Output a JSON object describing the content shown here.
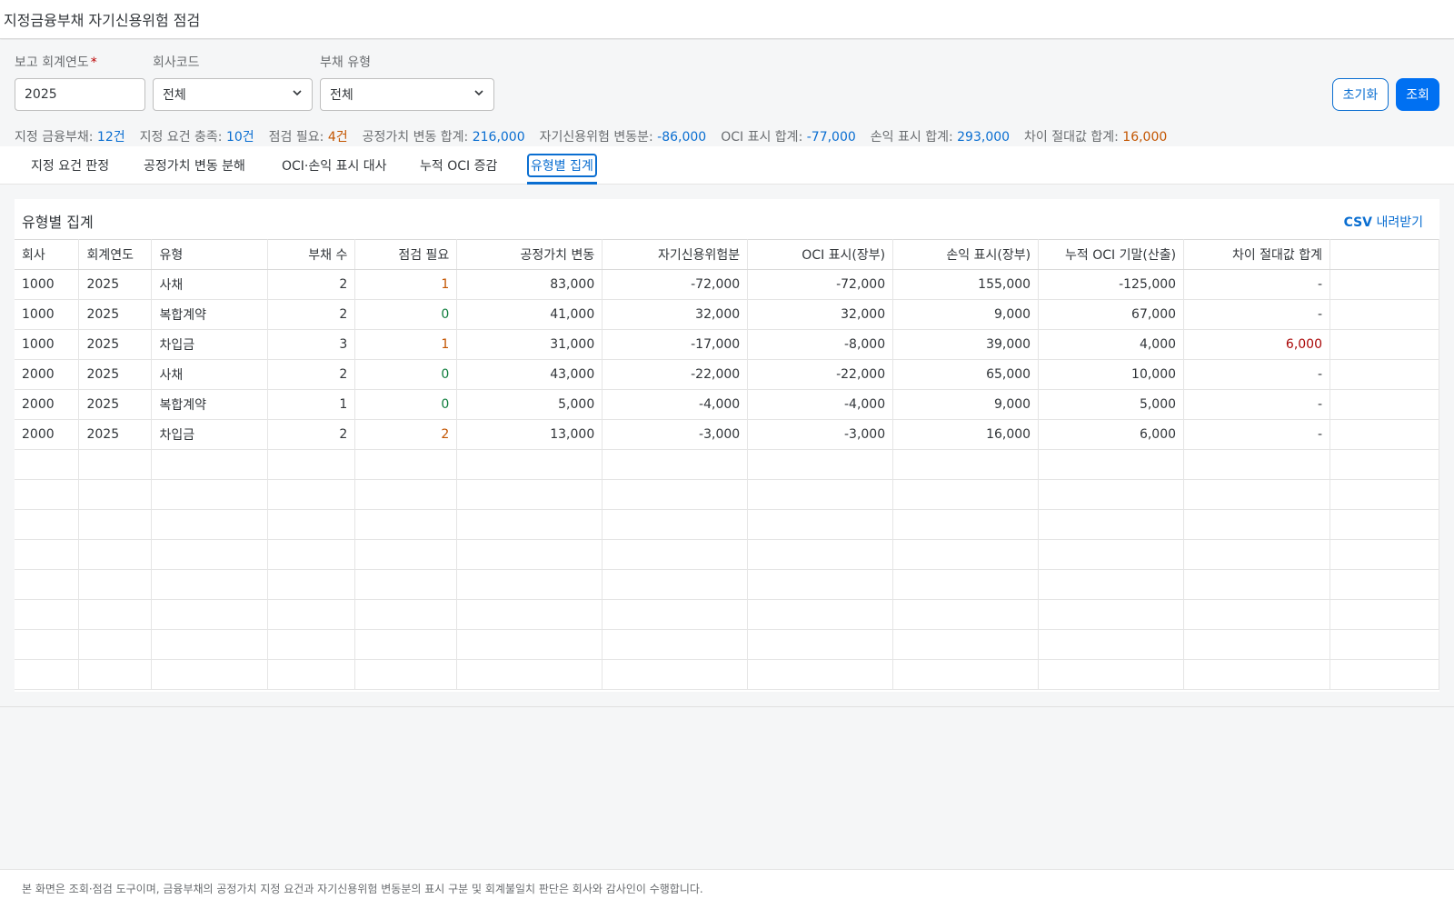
{
  "header": {
    "title": "지정금융부채 자기신용위험 점검"
  },
  "filters": {
    "year_label": "보고 회계연도",
    "year_required_mark": "*",
    "year_value": "2025",
    "company_label": "회사코드",
    "company_value": "전체",
    "liability_type_label": "부채 유형",
    "liability_type_value": "전체",
    "reset_label": "초기화",
    "search_label": "조회"
  },
  "summary": [
    {
      "label": "지정 금융부채: ",
      "value": "12건",
      "tone": "blue"
    },
    {
      "label": "지정 요건 충족: ",
      "value": "10건",
      "tone": "blue"
    },
    {
      "label": "점검 필요: ",
      "value": "4건",
      "tone": "orange"
    },
    {
      "label": "공정가치 변동 합계: ",
      "value": "216,000",
      "tone": "blue"
    },
    {
      "label": "자기신용위험 변동분: ",
      "value": "-86,000",
      "tone": "blue"
    },
    {
      "label": "OCI 표시 합계: ",
      "value": "-77,000",
      "tone": "blue"
    },
    {
      "label": "손익 표시 합계: ",
      "value": "293,000",
      "tone": "blue"
    },
    {
      "label": "차이 절대값 합계: ",
      "value": "16,000",
      "tone": "orange"
    }
  ],
  "tabs": [
    {
      "label": "지정 요건 판정",
      "active": false
    },
    {
      "label": "공정가치 변동 분해",
      "active": false
    },
    {
      "label": "OCI·손익 표시 대사",
      "active": false
    },
    {
      "label": "누적 OCI 증감",
      "active": false
    },
    {
      "label": "유형별 집계",
      "active": true
    }
  ],
  "panel": {
    "title": "유형별 집계",
    "csv_prefix": "CSV",
    "csv_suffix": " 내려받기"
  },
  "table": {
    "columns": [
      "회사",
      "회계연도",
      "유형",
      "부채 수",
      "점검 필요",
      "공정가치 변동",
      "자기신용위험분",
      "OCI 표시(장부)",
      "손익 표시(장부)",
      "누적 OCI 기말(산출)",
      "차이 절대값 합계"
    ],
    "rows": [
      [
        "1000",
        "2025",
        "사채",
        "2",
        "1",
        "83,000",
        "-72,000",
        "-72,000",
        "155,000",
        "-125,000",
        "-"
      ],
      [
        "1000",
        "2025",
        "복합계약",
        "2",
        "0",
        "41,000",
        "32,000",
        "32,000",
        "9,000",
        "67,000",
        "-"
      ],
      [
        "1000",
        "2025",
        "차입금",
        "3",
        "1",
        "31,000",
        "-17,000",
        "-8,000",
        "39,000",
        "4,000",
        "6,000"
      ],
      [
        "2000",
        "2025",
        "사채",
        "2",
        "0",
        "43,000",
        "-22,000",
        "-22,000",
        "65,000",
        "10,000",
        "-"
      ],
      [
        "2000",
        "2025",
        "복합계약",
        "1",
        "0",
        "5,000",
        "-4,000",
        "-4,000",
        "9,000",
        "5,000",
        "-"
      ],
      [
        "2000",
        "2025",
        "차입금",
        "2",
        "2",
        "13,000",
        "-3,000",
        "-3,000",
        "16,000",
        "6,000",
        "-"
      ]
    ],
    "empty_rows": 8
  },
  "footer": {
    "note": "본 화면은 조회·점검 도구이며, 금융부채의 공정가치 지정 요건과 자기신용위험 변동분의 표시 구분 및 회계불일치 판단은 회사와 감사인이 수행합니다."
  },
  "colors": {
    "accent": "#0a6ed1",
    "primary_button": "#0070f2",
    "warning": "#c35500",
    "positive": "#107e3e",
    "negative": "#aa0808"
  }
}
